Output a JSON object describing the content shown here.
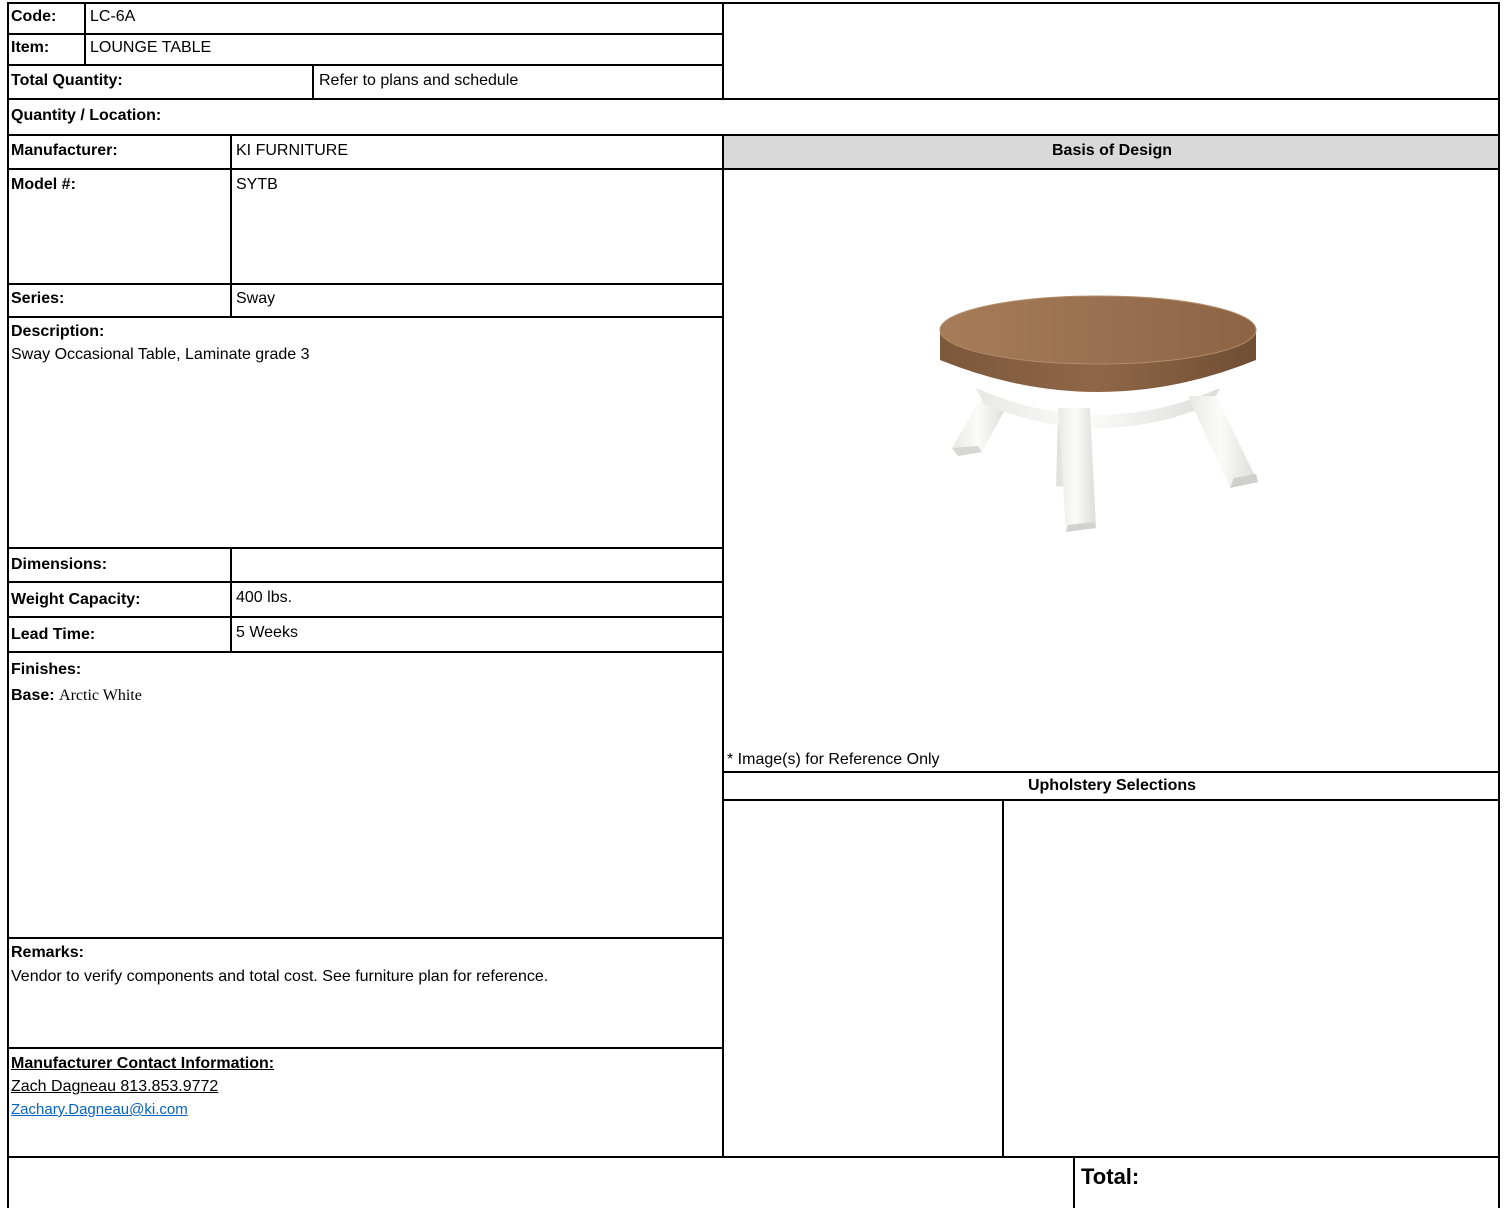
{
  "header": {
    "code_label": "Code:",
    "code_value": "LC-6A",
    "item_label": "Item:",
    "item_value": "LOUNGE TABLE",
    "total_quantity_label": "Total Quantity:",
    "total_quantity_value": "Refer to plans and schedule",
    "quantity_location_label": "Quantity / Location:"
  },
  "specs": {
    "manufacturer_label": "Manufacturer:",
    "manufacturer_value": "KI FURNITURE",
    "model_label": "Model #:",
    "model_value": "SYTB",
    "series_label": "Series:",
    "series_value": "Sway",
    "description_label": "Description:",
    "description_value": "Sway Occasional Table, Laminate grade 3",
    "dimensions_label": "Dimensions:",
    "dimensions_value": "",
    "weight_label": "Weight Capacity:",
    "weight_value": "400 lbs.",
    "lead_time_label": "Lead Time:",
    "lead_time_value": "5 Weeks",
    "finishes_label": "Finishes:",
    "finish_base_label": "Base:",
    "finish_base_value": "Arctic White",
    "remarks_label": "Remarks:",
    "remarks_value": "Vendor to verify components and total cost. See furniture plan for reference.",
    "contact_label": "Manufacturer Contact Information:",
    "contact_name_phone": "Zach Dagneau 813.853.9772",
    "contact_email": "Zachary.Dagneau@ki.com"
  },
  "right_panel": {
    "basis_of_design": "Basis of Design",
    "image_note": "* Image(s) for Reference Only",
    "upholstery_selections": "Upholstery Selections",
    "total_label": "Total:"
  },
  "colors": {
    "header_gray": "#d9d9d9",
    "link_blue": "#0563c1",
    "wood": "#9b7050",
    "base_white": "#f2f2f0"
  }
}
